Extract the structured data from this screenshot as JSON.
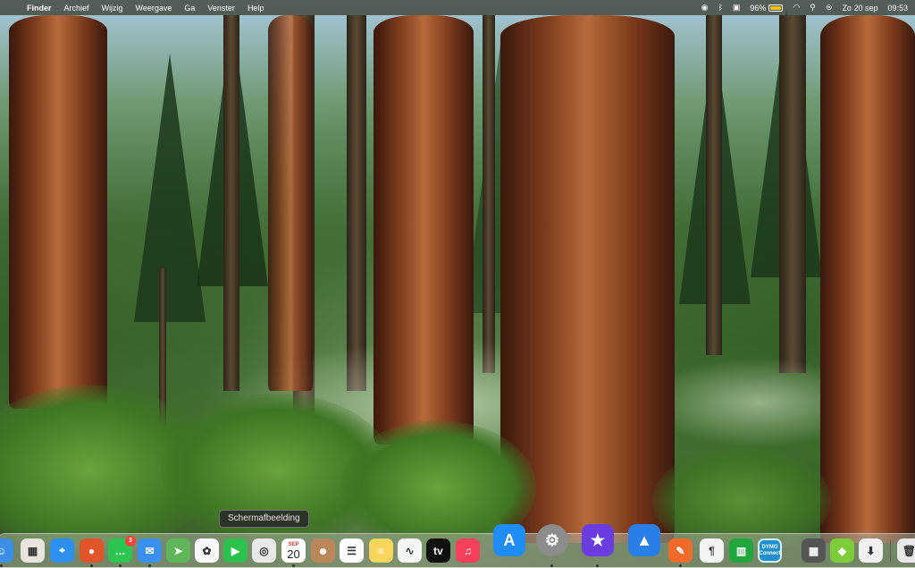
{
  "menubar": {
    "apple_icon": "",
    "items": [
      {
        "label": "Finder",
        "bold": true
      },
      {
        "label": "Archief"
      },
      {
        "label": "Wijzig"
      },
      {
        "label": "Weergave"
      },
      {
        "label": "Ga"
      },
      {
        "label": "Venster"
      },
      {
        "label": "Help"
      }
    ],
    "status": {
      "battery_percent_label": "96%",
      "battery_level": 0.96,
      "date": "Zo 20 sep",
      "time": "09:53"
    }
  },
  "tooltip": {
    "text": "Schermafbeelding"
  },
  "dock": {
    "icons": [
      {
        "name": "finder-icon",
        "glyph": "☺",
        "bg": "#3b8fe8"
      },
      {
        "name": "launchpad-icon",
        "glyph": "▦",
        "bg": "#e8e3dc"
      },
      {
        "name": "safari-icon",
        "glyph": "⌖",
        "bg": "#2d8ff0"
      },
      {
        "name": "firefox-icon",
        "glyph": "●",
        "bg": "#e2542a"
      },
      {
        "name": "messages-icon",
        "glyph": "…",
        "bg": "#2dc551"
      },
      {
        "name": "mail-icon",
        "glyph": "✉",
        "bg": "#3a8ff2"
      },
      {
        "name": "maps-icon",
        "glyph": "➤",
        "bg": "#5fb658"
      },
      {
        "name": "photos-icon",
        "glyph": "✿",
        "bg": "#f7f7f7"
      },
      {
        "name": "facetime-icon",
        "glyph": "▶",
        "bg": "#2bc14c"
      },
      {
        "name": "screenshot-icon",
        "glyph": "◎",
        "bg": "#e9e9e9"
      },
      {
        "name": "calendar-icon",
        "glyph": "",
        "bg": "#ffffff"
      },
      {
        "name": "contacts-icon",
        "glyph": "☻",
        "bg": "#b9875a"
      },
      {
        "name": "reminders-icon",
        "glyph": "☰",
        "bg": "#ffffff"
      },
      {
        "name": "notes-icon",
        "glyph": "≡",
        "bg": "#f8d65c"
      },
      {
        "name": "freeform-icon",
        "glyph": "∿",
        "bg": "#f5f5f5"
      },
      {
        "name": "apple-tv-icon",
        "glyph": "tv",
        "bg": "#111111"
      },
      {
        "name": "music-icon",
        "glyph": "♫",
        "bg": "#f7405a"
      },
      {
        "name": "app-store-icon",
        "glyph": "A",
        "bg": "#1f8df3"
      },
      {
        "name": "system-settings-icon",
        "glyph": "⚙",
        "bg": "#8c8c8c"
      },
      {
        "name": "imovie-icon",
        "glyph": "★",
        "bg": "#6a3de0"
      },
      {
        "name": "keynote-icon",
        "glyph": "▲",
        "bg": "#2a7ee8"
      },
      {
        "name": "pages-icon",
        "glyph": "✎",
        "bg": "#f06b2a"
      },
      {
        "name": "textedit-icon",
        "glyph": "¶",
        "bg": "#f3f3f3"
      },
      {
        "name": "numbers-icon",
        "glyph": "▥",
        "bg": "#21a63b"
      },
      {
        "name": "dymo-connect-icon",
        "glyph": "",
        "bg": "#1e8fd0"
      },
      {
        "name": "calculator-icon",
        "glyph": "▦",
        "bg": "#555555"
      },
      {
        "name": "cube-app-icon",
        "glyph": "◆",
        "bg": "#7dcd3b"
      },
      {
        "name": "installer-icon",
        "glyph": "⬇",
        "bg": "#f0f0f0"
      },
      {
        "name": "trash-icon",
        "glyph": "🗑",
        "bg": "#e8e8e8"
      }
    ],
    "messages_badge": "3",
    "calendar": {
      "month": "SEP",
      "day": "20"
    },
    "dymo": {
      "line1": "DYMO",
      "line2": "Connect"
    }
  }
}
